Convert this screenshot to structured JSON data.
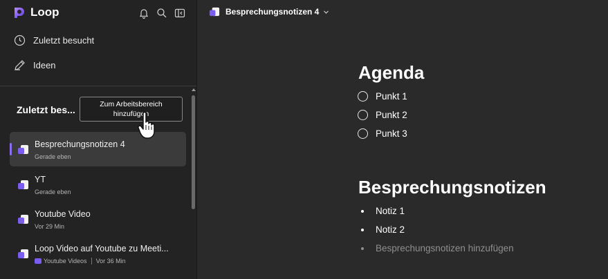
{
  "app": {
    "name": "Loop"
  },
  "colors": {
    "accent": "#8c6cf0",
    "sidebar_bg": "#232323",
    "main_bg": "#2b2a2a"
  },
  "sidebar": {
    "nav": [
      {
        "label": "Zuletzt besucht",
        "icon": "clock-icon"
      },
      {
        "label": "Ideen",
        "icon": "pen-icon"
      }
    ],
    "section_title": "Zuletzt bes...",
    "add_workspace_button": {
      "line1": "Zum Arbeitsbereich",
      "line2": "hinzufügen"
    },
    "pages": [
      {
        "title": "Besprechungsnotizen 4",
        "subtitle": "Gerade eben",
        "selected": true
      },
      {
        "title": "YT",
        "subtitle": "Gerade eben",
        "selected": false
      },
      {
        "title": "Youtube Video",
        "subtitle": "Vor 29 Min",
        "selected": false
      },
      {
        "title": "Loop Video auf Youtube zu Meeti...",
        "workspace": "Youtube Videos",
        "subtitle": "Vor 36 Min",
        "selected": false
      }
    ]
  },
  "main": {
    "breadcrumb": "Besprechungsnotizen 4",
    "agenda": {
      "heading": "Agenda",
      "items": [
        "Punkt 1",
        "Punkt 2",
        "Punkt 3"
      ]
    },
    "notes": {
      "heading": "Besprechungsnotizen",
      "items": [
        "Notiz 1",
        "Notiz 2"
      ],
      "placeholder": "Besprechungsnotizen hinzufügen"
    }
  }
}
